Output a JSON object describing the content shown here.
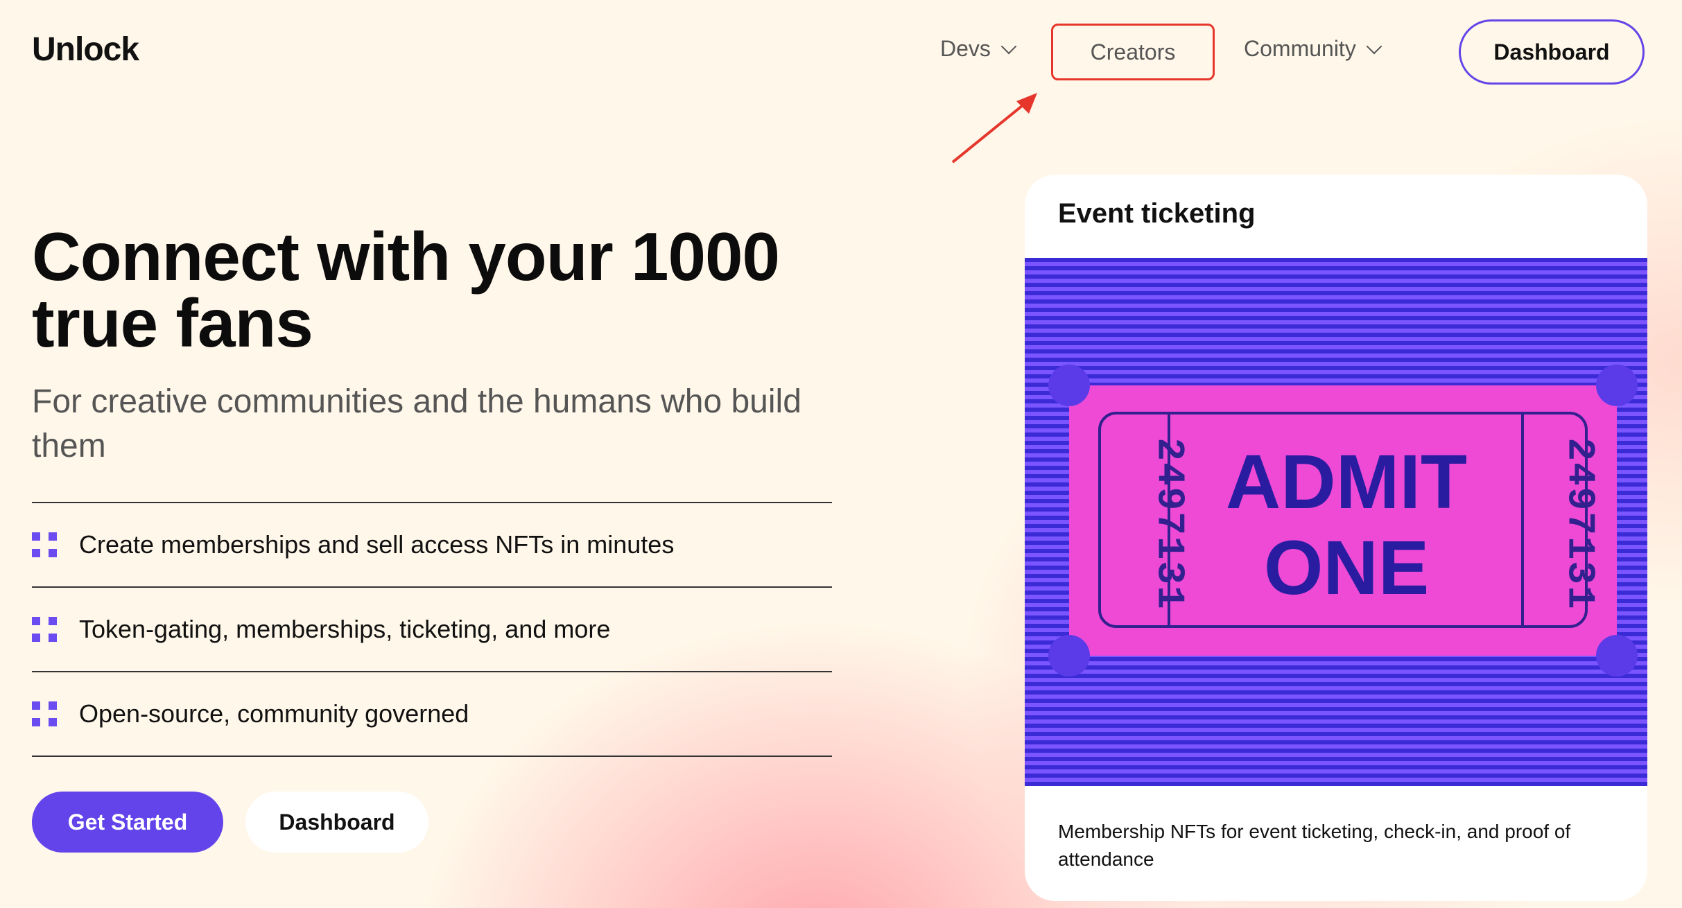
{
  "header": {
    "logo": "Unlock",
    "nav": {
      "devs": "Devs",
      "creators": "Creators",
      "community": "Community"
    },
    "dashboard_button": "Dashboard"
  },
  "hero": {
    "title": "Connect with your 1000 true fans",
    "subtitle": "For creative communities and the humans who build them",
    "features": [
      "Create memberships and sell access NFTs in minutes",
      "Token-gating, memberships, ticketing, and more",
      "Open-source, community governed"
    ],
    "get_started": "Get Started",
    "dashboard": "Dashboard"
  },
  "card": {
    "title": "Event ticketing",
    "ticket": {
      "line1": "ADMIT",
      "line2": "ONE",
      "number": "2497131"
    },
    "description": "Membership NFTs for event ticketing, check-in, and proof of attendance"
  },
  "colors": {
    "accent": "#6244ea",
    "highlight": "#e6362b",
    "ticket": "#ee4ad6",
    "background": "#fff7e9"
  },
  "icons": {
    "feature_bullet": "grid-dots-icon",
    "nav_dropdown": "chevron-down-icon",
    "annotation": "red-arrow-icon"
  }
}
